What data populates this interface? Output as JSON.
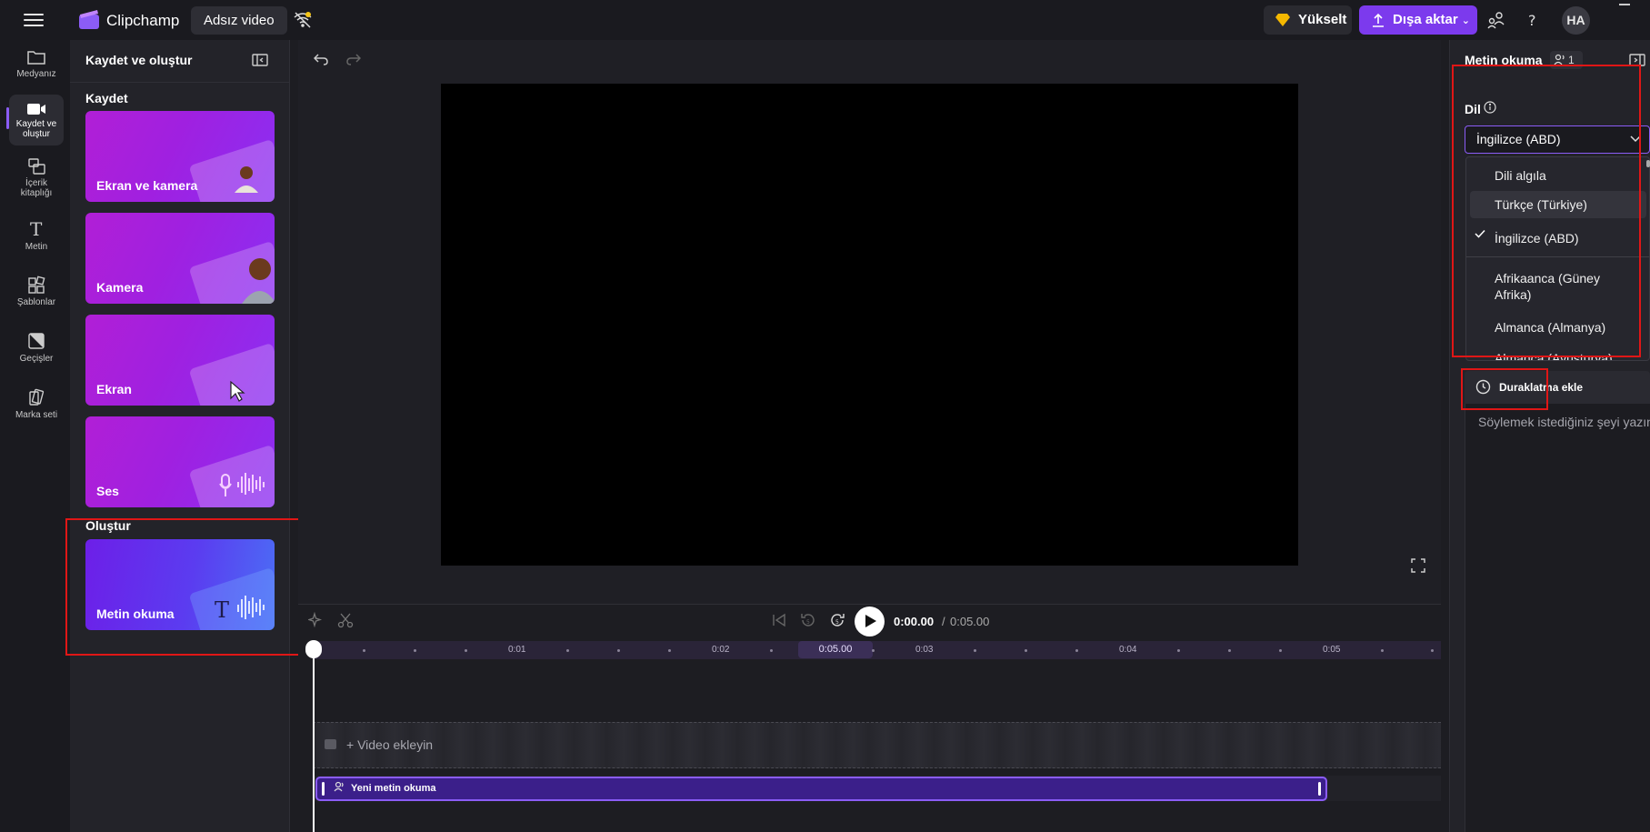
{
  "app": {
    "name": "Clipchamp",
    "project_name": "Adsız video"
  },
  "topbar": {
    "upgrade_label": "Yükselt",
    "export_label": "Dışa aktar",
    "avatar_initials": "HA"
  },
  "leftnav": {
    "items": [
      {
        "label": "Medyanız",
        "icon": "folder-icon"
      },
      {
        "label": "Kaydet ve oluştur",
        "icon": "video-camera-icon"
      },
      {
        "label": "İçerik kitaplığı",
        "icon": "content-library-icon"
      },
      {
        "label": "Metin",
        "icon": "text-icon"
      },
      {
        "label": "Şablonlar",
        "icon": "templates-icon"
      },
      {
        "label": "Geçişler",
        "icon": "transitions-icon"
      },
      {
        "label": "Marka seti",
        "icon": "brand-kit-icon"
      }
    ]
  },
  "panel": {
    "title": "Kaydet ve oluştur",
    "record_section": "Kaydet",
    "create_section": "Oluştur",
    "cards": [
      {
        "label": "Ekran ve kamera"
      },
      {
        "label": "Kamera"
      },
      {
        "label": "Ekran"
      },
      {
        "label": "Ses"
      }
    ],
    "tts_card": {
      "label": "Metin okuma"
    }
  },
  "timeline": {
    "time_current": "0:00.00",
    "time_separator": "/",
    "time_total": "0:05.00",
    "ticks": [
      "0:01",
      "0:02",
      "0:03",
      "0:04",
      "0:05"
    ],
    "marker": "0:05.00",
    "video_track_placeholder": "+ Video ekleyin",
    "tts_clip_label": "Yeni metin okuma"
  },
  "right_panel": {
    "title": "Metin okuma",
    "badge_count": "1",
    "language_label": "Dil",
    "selected_language": "İngilizce (ABD)",
    "dropdown_options": [
      {
        "label": "Dili algıla"
      },
      {
        "label": "Türkçe (Türkiye)"
      },
      {
        "label": "İngilizce (ABD)"
      },
      {
        "label": "Afrikaanca (Güney Afrika)"
      },
      {
        "label": "Almanca (Almanya)"
      },
      {
        "label": "Almanca (Avusturya)"
      }
    ],
    "pause_button": "Duraklatma ekle",
    "text_placeholder": "Söylemek istediğiniz şeyi yazın"
  },
  "colors": {
    "accent": "#7c3aed",
    "highlight_box": "#e01616",
    "card_gradient_start": "#b11fd6",
    "tts_clip": "#3b1f8a"
  }
}
